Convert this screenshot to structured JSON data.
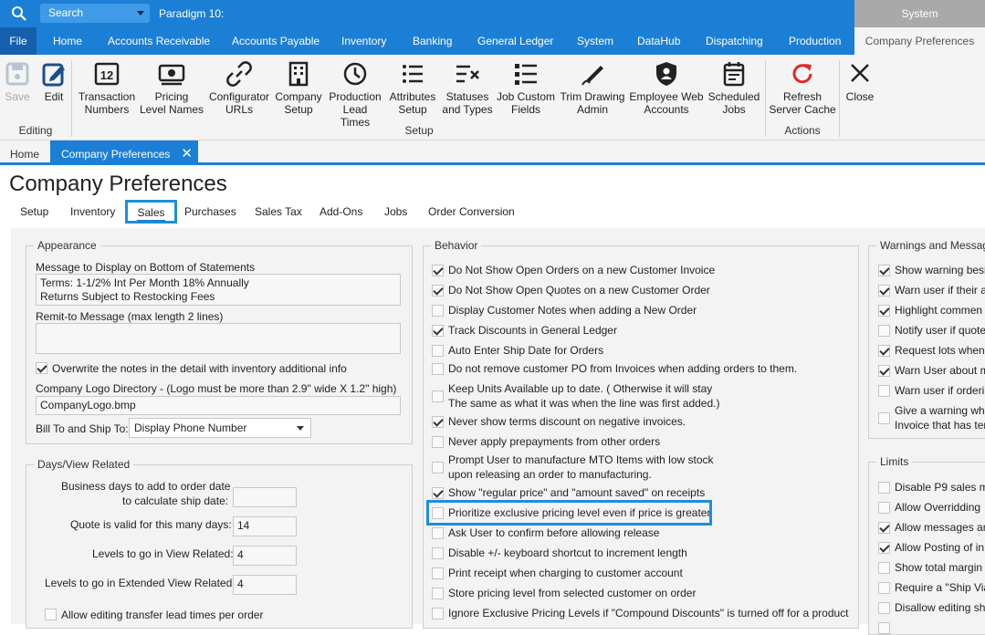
{
  "topbar": {
    "search_label": "Search",
    "app_title": "Paradigm 10:",
    "system_tab": "System"
  },
  "menu": {
    "file": "File",
    "items": [
      "Home",
      "Accounts Receivable",
      "Accounts Payable",
      "Inventory",
      "Banking",
      "General Ledger",
      "System",
      "DataHub",
      "Dispatching",
      "Production"
    ],
    "active": "Company Preferences"
  },
  "ribbon": {
    "save": "Save",
    "edit": "Edit",
    "editing_group": "Editing",
    "setup_buttons": [
      {
        "line1": "Transaction",
        "line2": "Numbers",
        "icon": "transaction-numbers-icon"
      },
      {
        "line1": "Pricing",
        "line2": "Level Names",
        "icon": "pricing-icon"
      },
      {
        "line1": "Configurator",
        "line2": "URLs",
        "icon": "link-icon"
      },
      {
        "line1": "Company",
        "line2": "Setup",
        "icon": "building-icon"
      },
      {
        "line1": "Production",
        "line2": "Lead Times",
        "icon": "clock-icon"
      },
      {
        "line1": "Attributes",
        "line2": "Setup",
        "icon": "list-icon"
      },
      {
        "line1": "Statuses",
        "line2": "and Types",
        "icon": "checklist-icon"
      },
      {
        "line1": "Job Custom",
        "line2": "Fields",
        "icon": "fields-icon"
      },
      {
        "line1": "Trim Drawing",
        "line2": "Admin",
        "icon": "pen-icon"
      },
      {
        "line1": "Employee Web",
        "line2": "Accounts",
        "icon": "shield-user-icon"
      },
      {
        "line1": "Scheduled",
        "line2": "Jobs",
        "icon": "calendar-icon"
      }
    ],
    "setup_group": "Setup",
    "refresh": {
      "line1": "Refresh",
      "line2": "Server Cache"
    },
    "actions_group": "Actions",
    "close": "Close"
  },
  "doc_tabs": {
    "home": "Home",
    "active": "Company Preferences"
  },
  "page_title": "Company Preferences",
  "sub_tabs": [
    "Setup",
    "Inventory",
    "Sales",
    "Purchases",
    "Sales Tax",
    "Add-Ons",
    "Jobs",
    "Order Conversion"
  ],
  "appearance": {
    "title": "Appearance",
    "msg_label": "Message to Display on Bottom of Statements",
    "msg_line1": "Terms: 1-1/2% Int Per Month 18% Annually",
    "msg_line2": "Returns Subject to Restocking Fees",
    "remit_label": "Remit-to Message (max length 2 lines)",
    "overwrite_label": "Overwrite the notes in the detail with inventory additional info",
    "logo_label": "Company Logo Directory - (Logo must be more than 2.9\" wide X 1.2\" high)",
    "logo_value": "CompanyLogo.bmp",
    "billto_label": "Bill To and Ship To:",
    "billto_value": "Display Phone Number"
  },
  "days": {
    "title": "Days/View Related",
    "business_l1": "Business days to add to order date",
    "business_l2": "to calculate ship date:",
    "business_value": "",
    "quote_label": "Quote is valid for this many days:",
    "quote_value": "14",
    "levels_label": "Levels to go in View Related:",
    "levels_value": "4",
    "ext_label": "Levels to go in Extended View Related:",
    "ext_value": "4",
    "transfer_label": "Allow editing transfer lead times per order"
  },
  "behavior": {
    "title": "Behavior",
    "items": [
      {
        "l1": "Do Not Show Open Orders on a new Customer Invoice",
        "l2": "",
        "checked": true
      },
      {
        "l1": "Do Not Show Open Quotes on a new Customer Order",
        "l2": "",
        "checked": true
      },
      {
        "l1": "Display Customer Notes when adding a New Order",
        "l2": "",
        "checked": false
      },
      {
        "l1": "Track Discounts in General Ledger",
        "l2": "",
        "checked": true
      },
      {
        "l1": "Auto Enter Ship Date for Orders",
        "l2": "",
        "checked": false
      },
      {
        "l1": "Do not remove customer PO from Invoices when adding orders to them.",
        "l2": "",
        "checked": false
      },
      {
        "l1": "Keep Units Available up to date. ( Otherwise it will stay",
        "l2": "The same as what it was when the line was first added.)",
        "checked": false
      },
      {
        "l1": "Never show terms discount on negative invoices.",
        "l2": "",
        "checked": true
      },
      {
        "l1": "Never apply prepayments from other orders",
        "l2": "",
        "checked": false
      },
      {
        "l1": "Prompt User to manufacture MTO Items with low stock",
        "l2": "upon releasing an order to manufacturing.",
        "checked": false
      },
      {
        "l1": "Show \"regular price\" and \"amount saved\" on receipts",
        "l2": "",
        "checked": true
      },
      {
        "l1": "Prioritize exclusive pricing level even if price is greater",
        "l2": "",
        "checked": false
      },
      {
        "l1": "Ask User to confirm before allowing release",
        "l2": "",
        "checked": false
      },
      {
        "l1": "Disable +/- keyboard shortcut to increment length",
        "l2": "",
        "checked": false
      },
      {
        "l1": "Print receipt when charging to customer account",
        "l2": "",
        "checked": false
      },
      {
        "l1": "Store pricing level from selected customer on order",
        "l2": "",
        "checked": false
      },
      {
        "l1": "Ignore Exclusive Pricing Levels if \"Compound Discounts\" is turned off for a product",
        "l2": "",
        "checked": false
      }
    ]
  },
  "warnings": {
    "title": "Warnings and Messag",
    "items": [
      {
        "l1": "Show warning besi",
        "l2": "",
        "checked": true
      },
      {
        "l1": "Warn user if their a",
        "l2": "",
        "checked": true
      },
      {
        "l1": "Highlight commen",
        "l2": "",
        "checked": true
      },
      {
        "l1": "Notify user if quote",
        "l2": "",
        "checked": false
      },
      {
        "l1": "Request lots when",
        "l2": "",
        "checked": true
      },
      {
        "l1": "Warn User about m",
        "l2": "",
        "checked": true
      },
      {
        "l1": "Warn user if orderi",
        "l2": "",
        "checked": false
      },
      {
        "l1": "Give a warning whe",
        "l2": "Invoice that has ter",
        "checked": false
      }
    ]
  },
  "limits": {
    "title": "Limits",
    "items": [
      {
        "l1": "Disable P9 sales m",
        "checked": false
      },
      {
        "l1": "Allow Overridding",
        "checked": false
      },
      {
        "l1": "Allow messages an",
        "checked": true
      },
      {
        "l1": "Allow Posting of in",
        "checked": true
      },
      {
        "l1": "Show total margin",
        "checked": false
      },
      {
        "l1": "Require a \"Ship Via",
        "checked": false
      },
      {
        "l1": "Disallow editing sh",
        "checked": false
      },
      {
        "l1": "",
        "checked": false
      }
    ]
  }
}
